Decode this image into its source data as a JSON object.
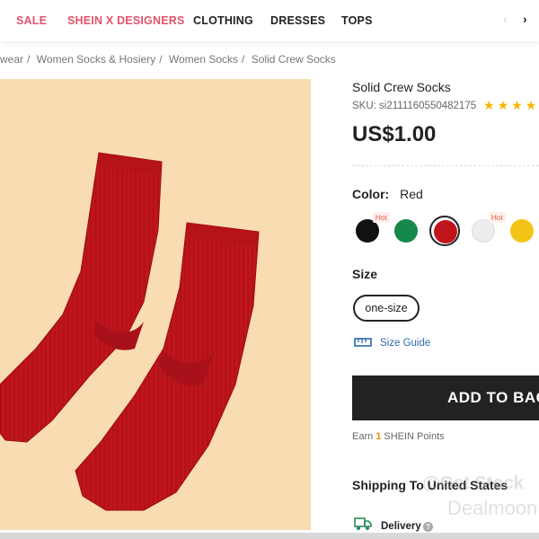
{
  "nav": {
    "items": [
      {
        "label": "SALE",
        "accent": "#e2536b"
      },
      {
        "label": "SHEIN X DESIGNERS",
        "accent": "#e2536b"
      },
      {
        "label": "CLOTHING"
      },
      {
        "label": "DRESSES"
      },
      {
        "label": "TOPS"
      }
    ],
    "prev_icon": "chevron-left-icon",
    "next_icon": "chevron-right-icon"
  },
  "breadcrumb": [
    "wear",
    "Women Socks & Hosiery",
    "Women Socks",
    "Solid Crew Socks"
  ],
  "product": {
    "title": "Solid Crew Socks",
    "sku": "SKU: si2111160550482175",
    "rating_icon": "star-icon",
    "price": "US$1.00",
    "color_label": "Color:",
    "color_value": "Red",
    "swatches": [
      {
        "name": "Black",
        "hex": "#111111",
        "hot": "Hot"
      },
      {
        "name": "Green",
        "hex": "#16894a"
      },
      {
        "name": "Red",
        "hex": "#c0141c",
        "selected": true
      },
      {
        "name": "White",
        "hex": "#ececec",
        "hot": "Hot"
      },
      {
        "name": "Yellow",
        "hex": "#f3c318"
      }
    ],
    "size_label": "Size",
    "size_option": "one-size",
    "size_guide": "Size Guide",
    "add_to_bag": "ADD TO BAG",
    "points_prefix": "Earn",
    "points_value": "1",
    "points_suffix": "SHEIN Points",
    "shipping_title": "Shipping To United States",
    "delivery_label": "Delivery",
    "help_glyph": "?"
  },
  "watermark": {
    "line1": "@Get Stock",
    "line2": "Dealmoon"
  },
  "colors": {
    "accent": "#e2536b",
    "image_bg": "#f9dcb2",
    "sock": "#c0141c",
    "link": "#2d68a8",
    "points": "#f08a00",
    "star": "#f6b700"
  }
}
